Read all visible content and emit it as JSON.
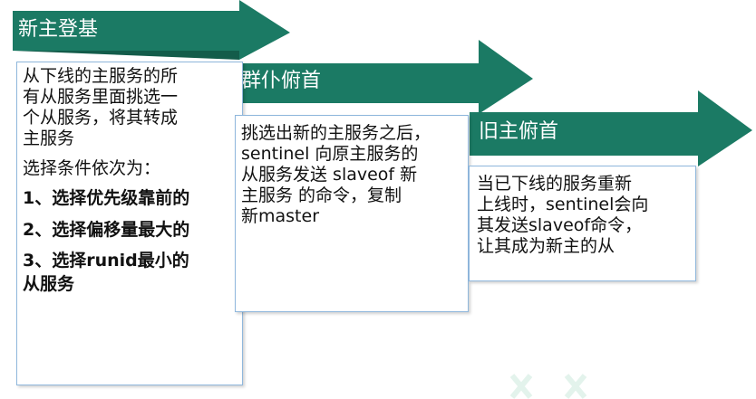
{
  "steps": [
    {
      "title": "新主登基",
      "lines": [
        "从下线的主服务的所",
        "有从服务里面挑选一",
        "个从服务，将其转成",
        "主服务"
      ],
      "subtitle": "选择条件依次为：",
      "criteria": [
        "1、选择优先级靠前的",
        "2、选择偏移量最大的",
        "3、选择runid最小的",
        "从服务"
      ]
    },
    {
      "title": "群仆俯首",
      "lines": [
        "挑选出新的主服务之后，",
        "sentinel 向原主服务的",
        "从服务发送 slaveof 新",
        "主服务 的命令，复制",
        "新master"
      ]
    },
    {
      "title": "旧主俯首",
      "lines": [
        "当已下线的服务重新",
        "上线时，sentinel会向",
        "其发送slaveof命令，",
        "让其成为新主的从"
      ]
    }
  ],
  "colors": {
    "arrow": "#1b7a64",
    "arrow_dark": "#135c4a",
    "box_border": "#8fb7dc"
  }
}
